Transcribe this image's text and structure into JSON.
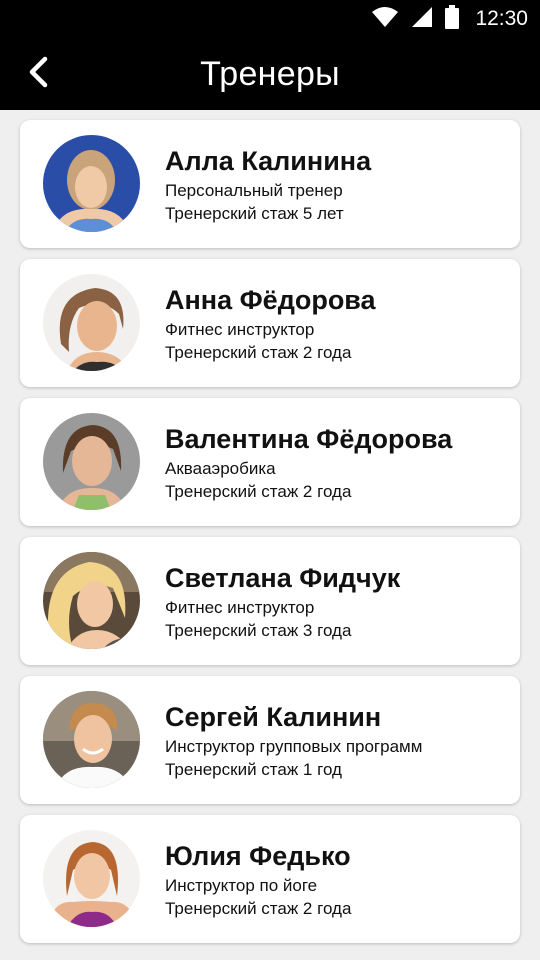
{
  "status_bar": {
    "time": "12:30"
  },
  "app_bar": {
    "title": "Тренеры"
  },
  "trainers": [
    {
      "name": "Алла Калинина",
      "role": "Персональный тренер",
      "experience": "Тренерский стаж 5 лет"
    },
    {
      "name": "Анна Фёдорова",
      "role": "Фитнес инструктор",
      "experience": "Тренерский стаж 2 года"
    },
    {
      "name": "Валентина Фёдорова",
      "role": "Аквааэробика",
      "experience": "Тренерский стаж 2 года"
    },
    {
      "name": "Светлана Фидчук",
      "role": "Фитнес инструктор",
      "experience": "Тренерский стаж 3 года"
    },
    {
      "name": "Сергей  Калинин",
      "role": "Инструктор групповых программ",
      "experience": "Тренерский стаж 1 год"
    },
    {
      "name": "Юлия Федько",
      "role": "Инструктор по йоге",
      "experience": "Тренерский стаж 2 года"
    }
  ],
  "colors": {
    "bar_background": "#000000",
    "page_background": "#efefef",
    "card_background": "#ffffff",
    "text": "#111111"
  },
  "icons": {
    "back": "back-arrow-icon",
    "wifi": "wifi-icon",
    "signal": "cell-signal-icon",
    "battery": "battery-icon"
  }
}
